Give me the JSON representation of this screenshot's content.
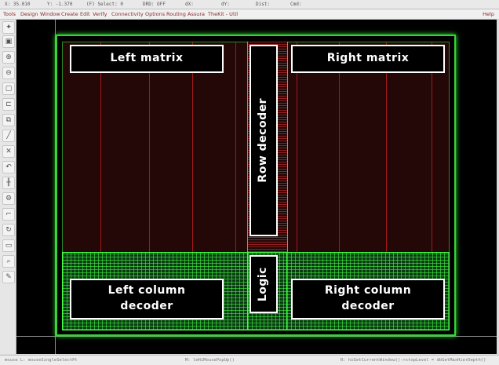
{
  "status": {
    "x": "X: 35.010",
    "y": "Y: -1.370",
    "select": "(F) Select: 0",
    "drd": "DRD: OFF",
    "dx": "dX:",
    "dy": "dY:",
    "dist": "Dist:",
    "cmd": "Cmd:"
  },
  "menu": {
    "items": [
      "Tools",
      "Design",
      "Window",
      "Create",
      "Edit",
      "Verify",
      "Connectivity",
      "Options",
      "Routing",
      "Assura",
      "TheKit - Util"
    ],
    "help": "Help"
  },
  "toolbar": {
    "icons": [
      "wand-icon",
      "save-icon",
      "zoom-in-icon",
      "zoom-out-icon",
      "fit-icon",
      "stretch-icon",
      "copy-icon",
      "ruler-icon",
      "delete-icon",
      "undo-icon",
      "split-icon",
      "properties-icon",
      "path-icon",
      "rotate-icon",
      "label-icon",
      "search-icon",
      "pen-icon"
    ]
  },
  "layout": {
    "left_matrix": "Left matrix",
    "right_matrix": "Right matrix",
    "row_decoder": "Row decoder",
    "logic": "Logic",
    "left_column_decoder": [
      "Left column",
      "decoder"
    ],
    "right_column_decoder": [
      "Right column",
      "decoder"
    ]
  },
  "bottom": {
    "mouse_l": "mouse L: mouseSingleSelectPt",
    "mouse_m": "M: leHiMousePopUp()",
    "mouse_r": "R: hiGetCurrentWindow()->stopLevel = dbGetMaxHierDepth()"
  }
}
